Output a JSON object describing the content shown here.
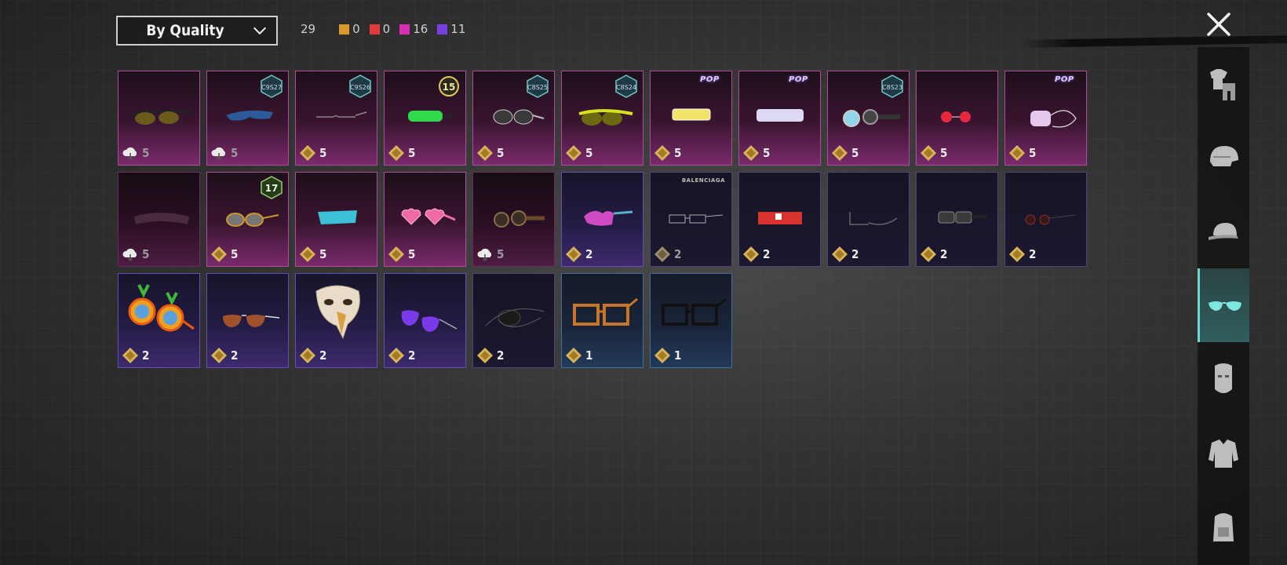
{
  "header": {
    "sort_label": "By Quality",
    "total_count": "29",
    "quality_counts": [
      {
        "color": "#d99a2b",
        "value": "0"
      },
      {
        "color": "#e23b3b",
        "value": "0"
      },
      {
        "color": "#d62fb4",
        "value": "16"
      },
      {
        "color": "#7a3fe0",
        "value": "11"
      }
    ]
  },
  "badges": {
    "c9s27": "C9S27",
    "c9s26": "C9S26",
    "c8s25": "C8S25",
    "c8s24": "C8S24",
    "c8s23": "C8S23",
    "lvl15": "15",
    "lvl17": "17",
    "pop": "POP",
    "balenciaga": "BALENCIAGA"
  },
  "items": [
    {
      "value": "5"
    },
    {
      "value": "5"
    },
    {
      "value": "5"
    },
    {
      "value": "5"
    },
    {
      "value": "5"
    },
    {
      "value": "5"
    },
    {
      "value": "5"
    },
    {
      "value": "5"
    },
    {
      "value": "5"
    },
    {
      "value": "5"
    },
    {
      "value": "5"
    },
    {
      "value": "5"
    },
    {
      "value": "5"
    },
    {
      "value": "5"
    },
    {
      "value": "5"
    },
    {
      "value": "5"
    },
    {
      "value": "2"
    },
    {
      "value": "2"
    },
    {
      "value": "2"
    },
    {
      "value": "2"
    },
    {
      "value": "2"
    },
    {
      "value": "2"
    },
    {
      "value": "2"
    },
    {
      "value": "2"
    },
    {
      "value": "2"
    },
    {
      "value": "2"
    },
    {
      "value": "2"
    },
    {
      "value": "1"
    },
    {
      "value": "1"
    }
  ],
  "sidebar": {
    "items": [
      {
        "icon": "outfit-icon"
      },
      {
        "icon": "helmet-icon"
      },
      {
        "icon": "cap-icon"
      },
      {
        "icon": "glasses-icon",
        "active": true
      },
      {
        "icon": "mask-icon"
      },
      {
        "icon": "jacket-icon"
      },
      {
        "icon": "backpack-icon"
      }
    ]
  }
}
